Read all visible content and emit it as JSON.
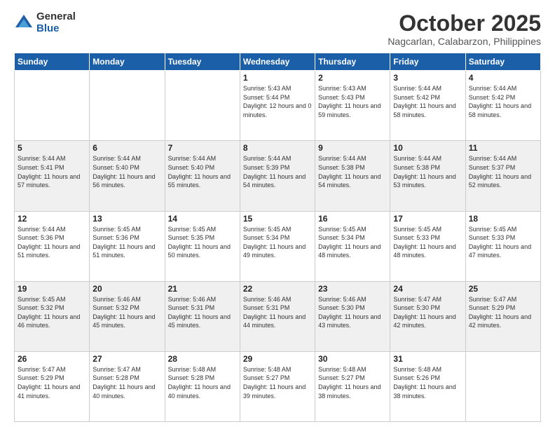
{
  "logo": {
    "general": "General",
    "blue": "Blue"
  },
  "header": {
    "month": "October 2025",
    "location": "Nagcarlan, Calabarzon, Philippines"
  },
  "weekdays": [
    "Sunday",
    "Monday",
    "Tuesday",
    "Wednesday",
    "Thursday",
    "Friday",
    "Saturday"
  ],
  "weeks": [
    [
      {
        "day": "",
        "sunrise": "",
        "sunset": "",
        "daylight": ""
      },
      {
        "day": "",
        "sunrise": "",
        "sunset": "",
        "daylight": ""
      },
      {
        "day": "",
        "sunrise": "",
        "sunset": "",
        "daylight": ""
      },
      {
        "day": "1",
        "sunrise": "Sunrise: 5:43 AM",
        "sunset": "Sunset: 5:44 PM",
        "daylight": "Daylight: 12 hours and 0 minutes."
      },
      {
        "day": "2",
        "sunrise": "Sunrise: 5:43 AM",
        "sunset": "Sunset: 5:43 PM",
        "daylight": "Daylight: 11 hours and 59 minutes."
      },
      {
        "day": "3",
        "sunrise": "Sunrise: 5:44 AM",
        "sunset": "Sunset: 5:42 PM",
        "daylight": "Daylight: 11 hours and 58 minutes."
      },
      {
        "day": "4",
        "sunrise": "Sunrise: 5:44 AM",
        "sunset": "Sunset: 5:42 PM",
        "daylight": "Daylight: 11 hours and 58 minutes."
      }
    ],
    [
      {
        "day": "5",
        "sunrise": "Sunrise: 5:44 AM",
        "sunset": "Sunset: 5:41 PM",
        "daylight": "Daylight: 11 hours and 57 minutes."
      },
      {
        "day": "6",
        "sunrise": "Sunrise: 5:44 AM",
        "sunset": "Sunset: 5:40 PM",
        "daylight": "Daylight: 11 hours and 56 minutes."
      },
      {
        "day": "7",
        "sunrise": "Sunrise: 5:44 AM",
        "sunset": "Sunset: 5:40 PM",
        "daylight": "Daylight: 11 hours and 55 minutes."
      },
      {
        "day": "8",
        "sunrise": "Sunrise: 5:44 AM",
        "sunset": "Sunset: 5:39 PM",
        "daylight": "Daylight: 11 hours and 54 minutes."
      },
      {
        "day": "9",
        "sunrise": "Sunrise: 5:44 AM",
        "sunset": "Sunset: 5:38 PM",
        "daylight": "Daylight: 11 hours and 54 minutes."
      },
      {
        "day": "10",
        "sunrise": "Sunrise: 5:44 AM",
        "sunset": "Sunset: 5:38 PM",
        "daylight": "Daylight: 11 hours and 53 minutes."
      },
      {
        "day": "11",
        "sunrise": "Sunrise: 5:44 AM",
        "sunset": "Sunset: 5:37 PM",
        "daylight": "Daylight: 11 hours and 52 minutes."
      }
    ],
    [
      {
        "day": "12",
        "sunrise": "Sunrise: 5:44 AM",
        "sunset": "Sunset: 5:36 PM",
        "daylight": "Daylight: 11 hours and 51 minutes."
      },
      {
        "day": "13",
        "sunrise": "Sunrise: 5:45 AM",
        "sunset": "Sunset: 5:36 PM",
        "daylight": "Daylight: 11 hours and 51 minutes."
      },
      {
        "day": "14",
        "sunrise": "Sunrise: 5:45 AM",
        "sunset": "Sunset: 5:35 PM",
        "daylight": "Daylight: 11 hours and 50 minutes."
      },
      {
        "day": "15",
        "sunrise": "Sunrise: 5:45 AM",
        "sunset": "Sunset: 5:34 PM",
        "daylight": "Daylight: 11 hours and 49 minutes."
      },
      {
        "day": "16",
        "sunrise": "Sunrise: 5:45 AM",
        "sunset": "Sunset: 5:34 PM",
        "daylight": "Daylight: 11 hours and 48 minutes."
      },
      {
        "day": "17",
        "sunrise": "Sunrise: 5:45 AM",
        "sunset": "Sunset: 5:33 PM",
        "daylight": "Daylight: 11 hours and 48 minutes."
      },
      {
        "day": "18",
        "sunrise": "Sunrise: 5:45 AM",
        "sunset": "Sunset: 5:33 PM",
        "daylight": "Daylight: 11 hours and 47 minutes."
      }
    ],
    [
      {
        "day": "19",
        "sunrise": "Sunrise: 5:45 AM",
        "sunset": "Sunset: 5:32 PM",
        "daylight": "Daylight: 11 hours and 46 minutes."
      },
      {
        "day": "20",
        "sunrise": "Sunrise: 5:46 AM",
        "sunset": "Sunset: 5:32 PM",
        "daylight": "Daylight: 11 hours and 45 minutes."
      },
      {
        "day": "21",
        "sunrise": "Sunrise: 5:46 AM",
        "sunset": "Sunset: 5:31 PM",
        "daylight": "Daylight: 11 hours and 45 minutes."
      },
      {
        "day": "22",
        "sunrise": "Sunrise: 5:46 AM",
        "sunset": "Sunset: 5:31 PM",
        "daylight": "Daylight: 11 hours and 44 minutes."
      },
      {
        "day": "23",
        "sunrise": "Sunrise: 5:46 AM",
        "sunset": "Sunset: 5:30 PM",
        "daylight": "Daylight: 11 hours and 43 minutes."
      },
      {
        "day": "24",
        "sunrise": "Sunrise: 5:47 AM",
        "sunset": "Sunset: 5:30 PM",
        "daylight": "Daylight: 11 hours and 42 minutes."
      },
      {
        "day": "25",
        "sunrise": "Sunrise: 5:47 AM",
        "sunset": "Sunset: 5:29 PM",
        "daylight": "Daylight: 11 hours and 42 minutes."
      }
    ],
    [
      {
        "day": "26",
        "sunrise": "Sunrise: 5:47 AM",
        "sunset": "Sunset: 5:29 PM",
        "daylight": "Daylight: 11 hours and 41 minutes."
      },
      {
        "day": "27",
        "sunrise": "Sunrise: 5:47 AM",
        "sunset": "Sunset: 5:28 PM",
        "daylight": "Daylight: 11 hours and 40 minutes."
      },
      {
        "day": "28",
        "sunrise": "Sunrise: 5:48 AM",
        "sunset": "Sunset: 5:28 PM",
        "daylight": "Daylight: 11 hours and 40 minutes."
      },
      {
        "day": "29",
        "sunrise": "Sunrise: 5:48 AM",
        "sunset": "Sunset: 5:27 PM",
        "daylight": "Daylight: 11 hours and 39 minutes."
      },
      {
        "day": "30",
        "sunrise": "Sunrise: 5:48 AM",
        "sunset": "Sunset: 5:27 PM",
        "daylight": "Daylight: 11 hours and 38 minutes."
      },
      {
        "day": "31",
        "sunrise": "Sunrise: 5:48 AM",
        "sunset": "Sunset: 5:26 PM",
        "daylight": "Daylight: 11 hours and 38 minutes."
      },
      {
        "day": "",
        "sunrise": "",
        "sunset": "",
        "daylight": ""
      }
    ]
  ]
}
